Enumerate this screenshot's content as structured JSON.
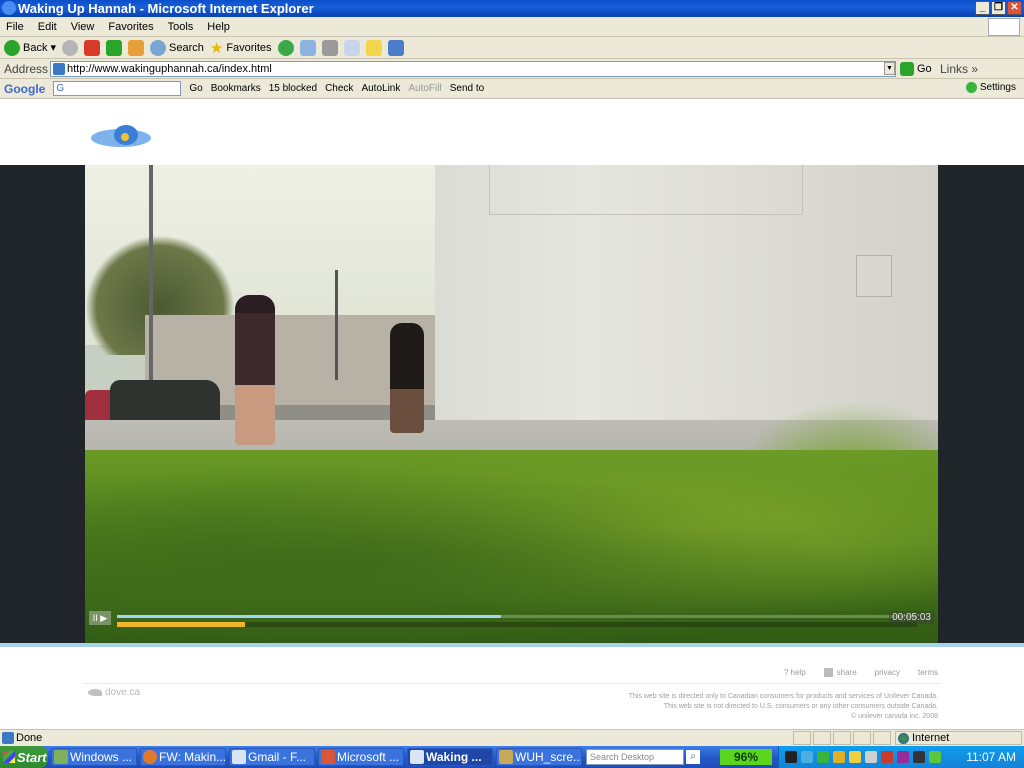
{
  "window": {
    "title": "Waking Up Hannah - Microsoft Internet Explorer"
  },
  "menu": [
    "File",
    "Edit",
    "View",
    "Favorites",
    "Tools",
    "Help"
  ],
  "toolbar": {
    "back": "Back",
    "search": "Search",
    "favorites": "Favorites"
  },
  "address": {
    "label": "Address",
    "url": "http://www.wakinguphannah.ca/index.html",
    "go": "Go",
    "links": "Links"
  },
  "google": {
    "logo": "Google",
    "search_value": "G",
    "go": "Go",
    "bookmarks": "Bookmarks",
    "blocked": "15 blocked",
    "check": "Check",
    "autolink": "AutoLink",
    "autofill": "AutoFill",
    "sendto": "Send to",
    "settings": "Settings"
  },
  "player": {
    "time": "00:05:03",
    "play_symbol": "II ▶",
    "progress_loaded": 0.48,
    "progress_played": 0.16
  },
  "footer": {
    "links": [
      "help",
      "share",
      "privacy",
      "terms"
    ],
    "brand": "dove.ca",
    "disclaimer": [
      "This web site is directed only to Canadian consumers for products and services of Unilever Canada.",
      "This web site is not directed to U.S. consumers or any other consumers outside Canada.",
      "© unilever canada inc. 2008"
    ]
  },
  "status": {
    "text": "Done",
    "zone": "Internet"
  },
  "taskbar": {
    "start": "Start",
    "tasks": [
      "Windows ...",
      "FW: Makin...",
      "Gmail - F...",
      "Microsoft ...",
      "Waking ...",
      "WUH_scre..."
    ],
    "search_placeholder": "Search Desktop",
    "battery": "96%",
    "clock": "11:07 AM"
  },
  "colors": {
    "title_blue": "#0a4fc9",
    "player_progress": "#9fd6f2",
    "player_buffer": "#f0b42d",
    "taskbar_blue": "#2459c9"
  }
}
